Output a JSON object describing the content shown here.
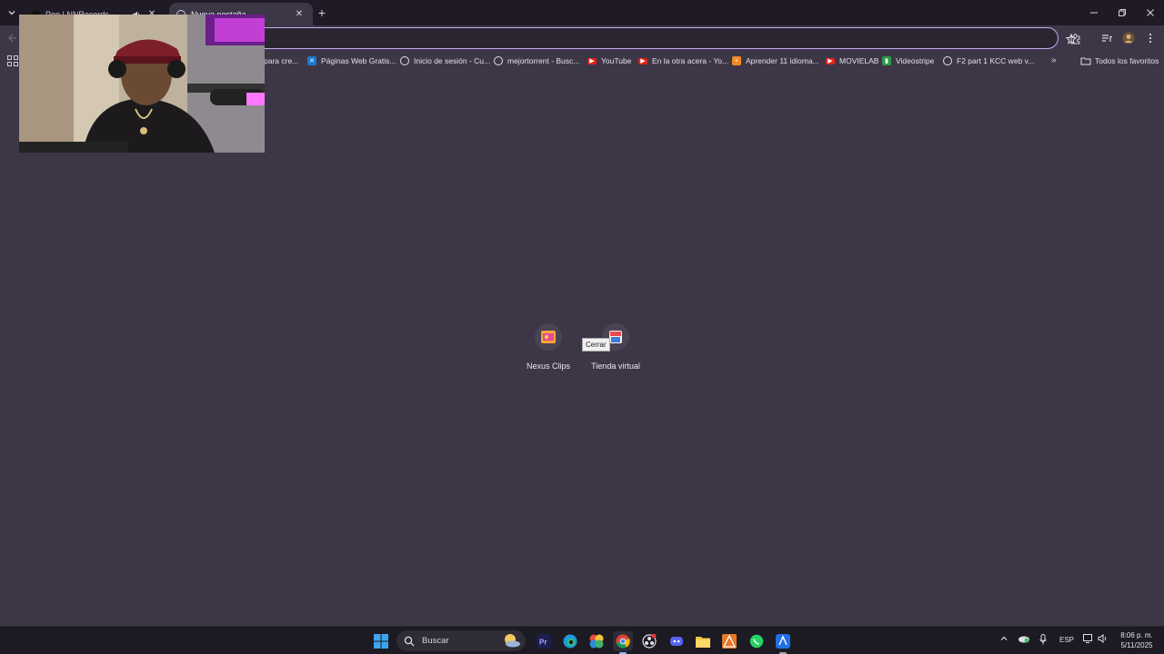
{
  "tabs": [
    {
      "title": "Pop | NNRecords",
      "active": false
    },
    {
      "title": "Nueva pestaña",
      "active": true
    }
  ],
  "omnibox": {
    "value": "",
    "placeholder": ""
  },
  "bookmarks": [
    {
      "label": "para cre...",
      "icon": "generic-icon"
    },
    {
      "label": "Páginas Web Gratis...",
      "icon": "x-icon"
    },
    {
      "label": "Inicio de sesión - Cu...",
      "icon": "google-icon"
    },
    {
      "label": "mejortorrent - Busc...",
      "icon": "google-icon"
    },
    {
      "label": "YouTube",
      "icon": "youtube-icon"
    },
    {
      "label": "En la otra acera - Yo...",
      "icon": "youtube-icon"
    },
    {
      "label": "Aprender 11 idioma...",
      "icon": "orange-icon"
    },
    {
      "label": "MOVIELAB",
      "icon": "youtube-icon"
    },
    {
      "label": "Videostripe",
      "icon": "green-icon"
    },
    {
      "label": "F2 part 1 KCC web v...",
      "icon": "globe-icon"
    }
  ],
  "bookmarks_all": "Todos los favoritos",
  "shortcuts": [
    {
      "label": "Nexus Clips"
    },
    {
      "label": "Tienda virtual"
    }
  ],
  "tooltip": "Cerrar",
  "taskbar": {
    "search_label": "Buscar",
    "language": "ESP",
    "time": "8:06 p. m.",
    "date": "5/11/2025"
  },
  "colors": {
    "accent": "#c7a8ef",
    "page_background": "#3d3647",
    "tabstrip": "#1f1a25",
    "taskbar": "#1c1a22"
  }
}
